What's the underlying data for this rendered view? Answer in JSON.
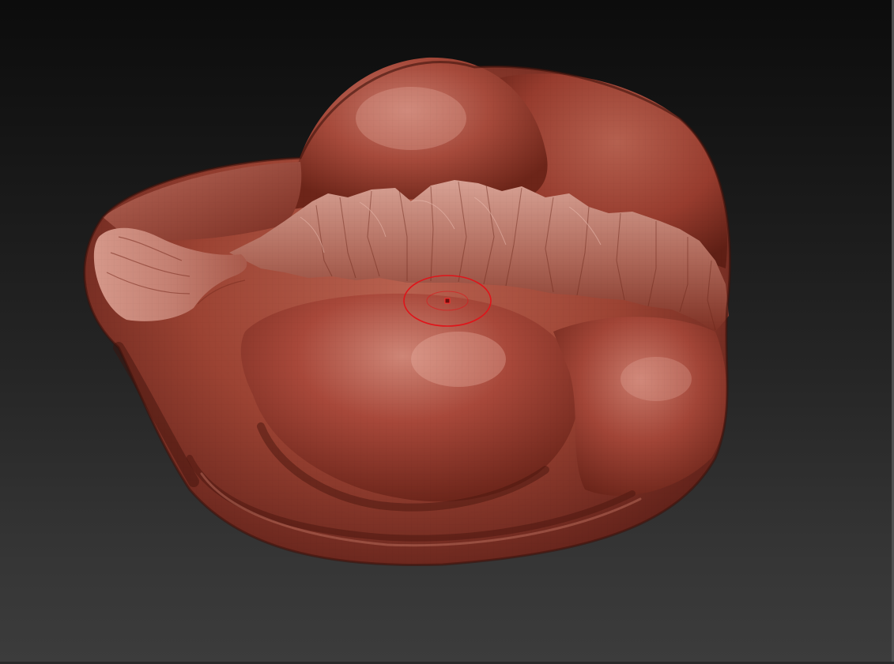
{
  "viewport": {
    "background_top": "#0c0c0c",
    "background_bottom": "#3c3c3c"
  },
  "model": {
    "material_color": "#a8483a",
    "highlight_color": "#d88a7c",
    "shadow_color": "#5a1c14"
  },
  "brush_cursor": {
    "icon": "brush-circle-icon",
    "color": "#e0141a"
  }
}
